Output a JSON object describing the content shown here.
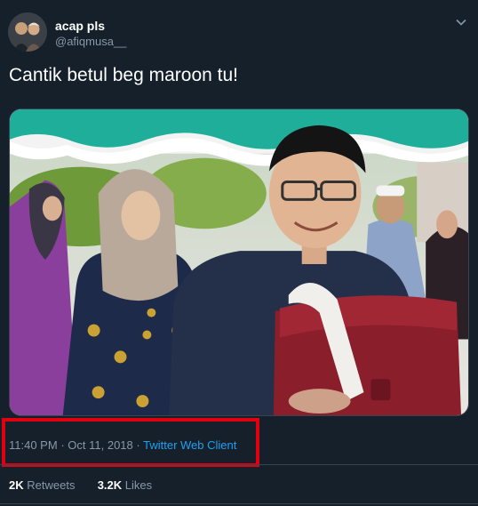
{
  "user": {
    "display_name": "acap pls",
    "handle": "@afiqmusa__"
  },
  "tweet": {
    "text": "Cantik betul beg maroon tu!",
    "time": "11:40 PM",
    "separator": "·",
    "date": "Oct 11, 2018",
    "client": "Twitter Web Client"
  },
  "stats": {
    "retweets_count": "2K",
    "retweets_label": "Retweets",
    "likes_count": "3.2K",
    "likes_label": "Likes"
  },
  "colors": {
    "background": "#15202b",
    "secondary_text": "#8899a6",
    "link": "#1da1f2",
    "highlight_box": "#e0000f"
  },
  "icons": [
    "avatar",
    "chevron-down-icon"
  ]
}
